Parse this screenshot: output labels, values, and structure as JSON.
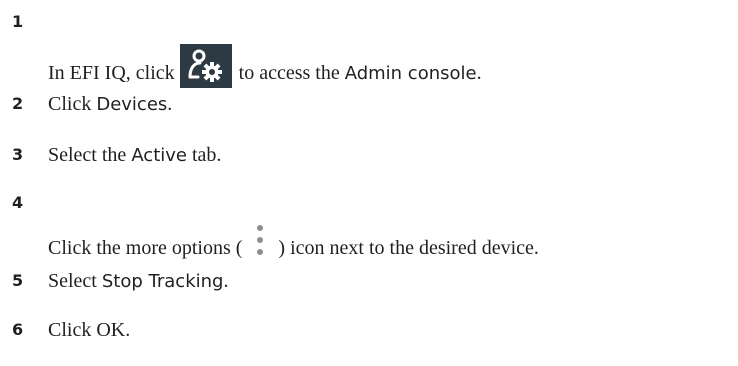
{
  "steps": [
    {
      "number": "1",
      "parts": [
        "In EFI IQ, click",
        "to access the",
        "Admin console",
        "."
      ],
      "icon": "admin-settings-icon"
    },
    {
      "number": "2",
      "parts": [
        "Click",
        "Devices",
        "."
      ]
    },
    {
      "number": "3",
      "parts": [
        "Select the",
        "Active",
        "tab."
      ]
    },
    {
      "number": "4",
      "parts": [
        "Click the more options (",
        ") icon next to the desired device."
      ],
      "icon": "more-options-icon"
    },
    {
      "number": "5",
      "parts": [
        "Select",
        "Stop Tracking",
        "."
      ]
    },
    {
      "number": "6",
      "parts": [
        "Click OK."
      ]
    }
  ],
  "colors": {
    "text": "#231f20",
    "icon_background": "#2d3a43",
    "icon_foreground": "#ffffff",
    "kebab_dots": "#8a8f94"
  }
}
